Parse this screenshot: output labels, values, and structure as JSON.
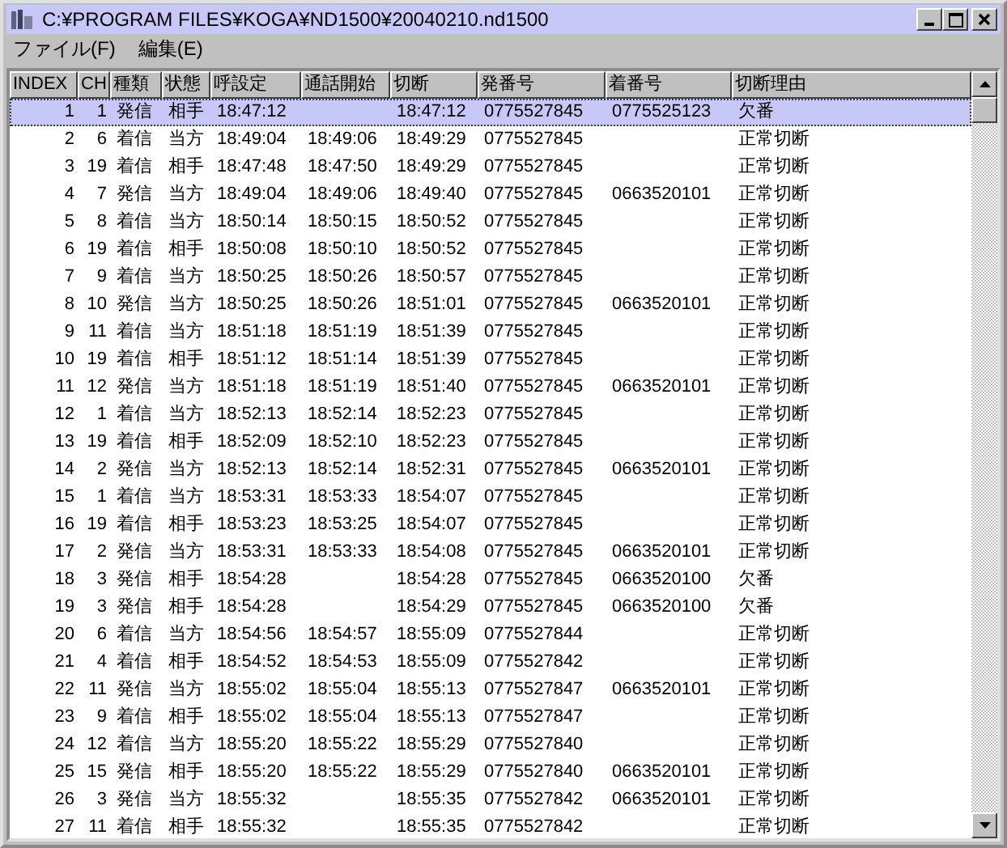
{
  "window": {
    "title": "C:¥PROGRAM FILES¥KOGA¥ND1500¥20040210.nd1500"
  },
  "menu": [
    {
      "label": "ファイル(F)"
    },
    {
      "label": "編集(E)"
    }
  ],
  "table": {
    "columns": [
      "INDEX",
      "CH",
      "種類",
      "状態",
      "呼設定",
      "通話開始",
      "切断",
      "発番号",
      "着番号",
      "切断理由"
    ],
    "rows": [
      {
        "index": "1",
        "ch": "1",
        "type": "発信",
        "side": "相手",
        "setup": "18:47:12",
        "end": "18:47:12",
        "caller": "0775527845",
        "callee": "0775525123",
        "reason": "欠番",
        "selected": true
      },
      {
        "index": "2",
        "ch": "6",
        "type": "着信",
        "side": "当方",
        "setup": "18:49:04",
        "start": "18:49:06",
        "end": "18:49:29",
        "caller": "0775527845",
        "reason": "正常切断",
        "selected": false
      },
      {
        "index": "3",
        "ch": "19",
        "type": "着信",
        "side": "相手",
        "setup": "18:47:48",
        "start": "18:47:50",
        "end": "18:49:29",
        "caller": "0775527845",
        "reason": "正常切断",
        "selected": false
      },
      {
        "index": "4",
        "ch": "7",
        "type": "発信",
        "side": "当方",
        "setup": "18:49:04",
        "start": "18:49:06",
        "end": "18:49:40",
        "caller": "0775527845",
        "callee": "0663520101",
        "reason": "正常切断",
        "selected": false
      },
      {
        "index": "5",
        "ch": "8",
        "type": "着信",
        "side": "当方",
        "setup": "18:50:14",
        "start": "18:50:15",
        "end": "18:50:52",
        "caller": "0775527845",
        "reason": "正常切断",
        "selected": false
      },
      {
        "index": "6",
        "ch": "19",
        "type": "着信",
        "side": "相手",
        "setup": "18:50:08",
        "start": "18:50:10",
        "end": "18:50:52",
        "caller": "0775527845",
        "reason": "正常切断",
        "selected": false
      },
      {
        "index": "7",
        "ch": "9",
        "type": "着信",
        "side": "当方",
        "setup": "18:50:25",
        "start": "18:50:26",
        "end": "18:50:57",
        "caller": "0775527845",
        "reason": "正常切断",
        "selected": false
      },
      {
        "index": "8",
        "ch": "10",
        "type": "発信",
        "side": "当方",
        "setup": "18:50:25",
        "start": "18:50:26",
        "end": "18:51:01",
        "caller": "0775527845",
        "callee": "0663520101",
        "reason": "正常切断",
        "selected": false
      },
      {
        "index": "9",
        "ch": "11",
        "type": "着信",
        "side": "当方",
        "setup": "18:51:18",
        "start": "18:51:19",
        "end": "18:51:39",
        "caller": "0775527845",
        "reason": "正常切断",
        "selected": false
      },
      {
        "index": "10",
        "ch": "19",
        "type": "着信",
        "side": "相手",
        "setup": "18:51:12",
        "start": "18:51:14",
        "end": "18:51:39",
        "caller": "0775527845",
        "reason": "正常切断",
        "selected": false
      },
      {
        "index": "11",
        "ch": "12",
        "type": "発信",
        "side": "当方",
        "setup": "18:51:18",
        "start": "18:51:19",
        "end": "18:51:40",
        "caller": "0775527845",
        "callee": "0663520101",
        "reason": "正常切断",
        "selected": false
      },
      {
        "index": "12",
        "ch": "1",
        "type": "着信",
        "side": "当方",
        "setup": "18:52:13",
        "start": "18:52:14",
        "end": "18:52:23",
        "caller": "0775527845",
        "reason": "正常切断",
        "selected": false
      },
      {
        "index": "13",
        "ch": "19",
        "type": "着信",
        "side": "相手",
        "setup": "18:52:09",
        "start": "18:52:10",
        "end": "18:52:23",
        "caller": "0775527845",
        "reason": "正常切断",
        "selected": false
      },
      {
        "index": "14",
        "ch": "2",
        "type": "発信",
        "side": "当方",
        "setup": "18:52:13",
        "start": "18:52:14",
        "end": "18:52:31",
        "caller": "0775527845",
        "callee": "0663520101",
        "reason": "正常切断",
        "selected": false
      },
      {
        "index": "15",
        "ch": "1",
        "type": "着信",
        "side": "当方",
        "setup": "18:53:31",
        "start": "18:53:33",
        "end": "18:54:07",
        "caller": "0775527845",
        "reason": "正常切断",
        "selected": false
      },
      {
        "index": "16",
        "ch": "19",
        "type": "着信",
        "side": "相手",
        "setup": "18:53:23",
        "start": "18:53:25",
        "end": "18:54:07",
        "caller": "0775527845",
        "reason": "正常切断",
        "selected": false
      },
      {
        "index": "17",
        "ch": "2",
        "type": "発信",
        "side": "当方",
        "setup": "18:53:31",
        "start": "18:53:33",
        "end": "18:54:08",
        "caller": "0775527845",
        "callee": "0663520101",
        "reason": "正常切断",
        "selected": false
      },
      {
        "index": "18",
        "ch": "3",
        "type": "発信",
        "side": "相手",
        "setup": "18:54:28",
        "end": "18:54:28",
        "caller": "0775527845",
        "callee": "0663520100",
        "reason": "欠番",
        "selected": false
      },
      {
        "index": "19",
        "ch": "3",
        "type": "発信",
        "side": "相手",
        "setup": "18:54:28",
        "end": "18:54:29",
        "caller": "0775527845",
        "callee": "0663520100",
        "reason": "欠番",
        "selected": false
      },
      {
        "index": "20",
        "ch": "6",
        "type": "着信",
        "side": "当方",
        "setup": "18:54:56",
        "start": "18:54:57",
        "end": "18:55:09",
        "caller": "0775527844",
        "reason": "正常切断",
        "selected": false
      },
      {
        "index": "21",
        "ch": "4",
        "type": "着信",
        "side": "相手",
        "setup": "18:54:52",
        "start": "18:54:53",
        "end": "18:55:09",
        "caller": "0775527842",
        "reason": "正常切断",
        "selected": false
      },
      {
        "index": "22",
        "ch": "11",
        "type": "発信",
        "side": "当方",
        "setup": "18:55:02",
        "start": "18:55:04",
        "end": "18:55:13",
        "caller": "0775527847",
        "callee": "0663520101",
        "reason": "正常切断",
        "selected": false
      },
      {
        "index": "23",
        "ch": "9",
        "type": "着信",
        "side": "相手",
        "setup": "18:55:02",
        "start": "18:55:04",
        "end": "18:55:13",
        "caller": "0775527847",
        "reason": "正常切断",
        "selected": false
      },
      {
        "index": "24",
        "ch": "12",
        "type": "着信",
        "side": "当方",
        "setup": "18:55:20",
        "start": "18:55:22",
        "end": "18:55:29",
        "caller": "0775527840",
        "reason": "正常切断",
        "selected": false
      },
      {
        "index": "25",
        "ch": "15",
        "type": "発信",
        "side": "相手",
        "setup": "18:55:20",
        "start": "18:55:22",
        "end": "18:55:29",
        "caller": "0775527840",
        "callee": "0663520101",
        "reason": "正常切断",
        "selected": false
      },
      {
        "index": "26",
        "ch": "3",
        "type": "発信",
        "side": "当方",
        "setup": "18:55:32",
        "end": "18:55:35",
        "caller": "0775527842",
        "callee": "0663520101",
        "reason": "正常切断",
        "selected": false
      },
      {
        "index": "27",
        "ch": "11",
        "type": "着信",
        "side": "相手",
        "setup": "18:55:32",
        "end": "18:55:35",
        "caller": "0775527842",
        "reason": "正常切断",
        "selected": false
      }
    ]
  }
}
